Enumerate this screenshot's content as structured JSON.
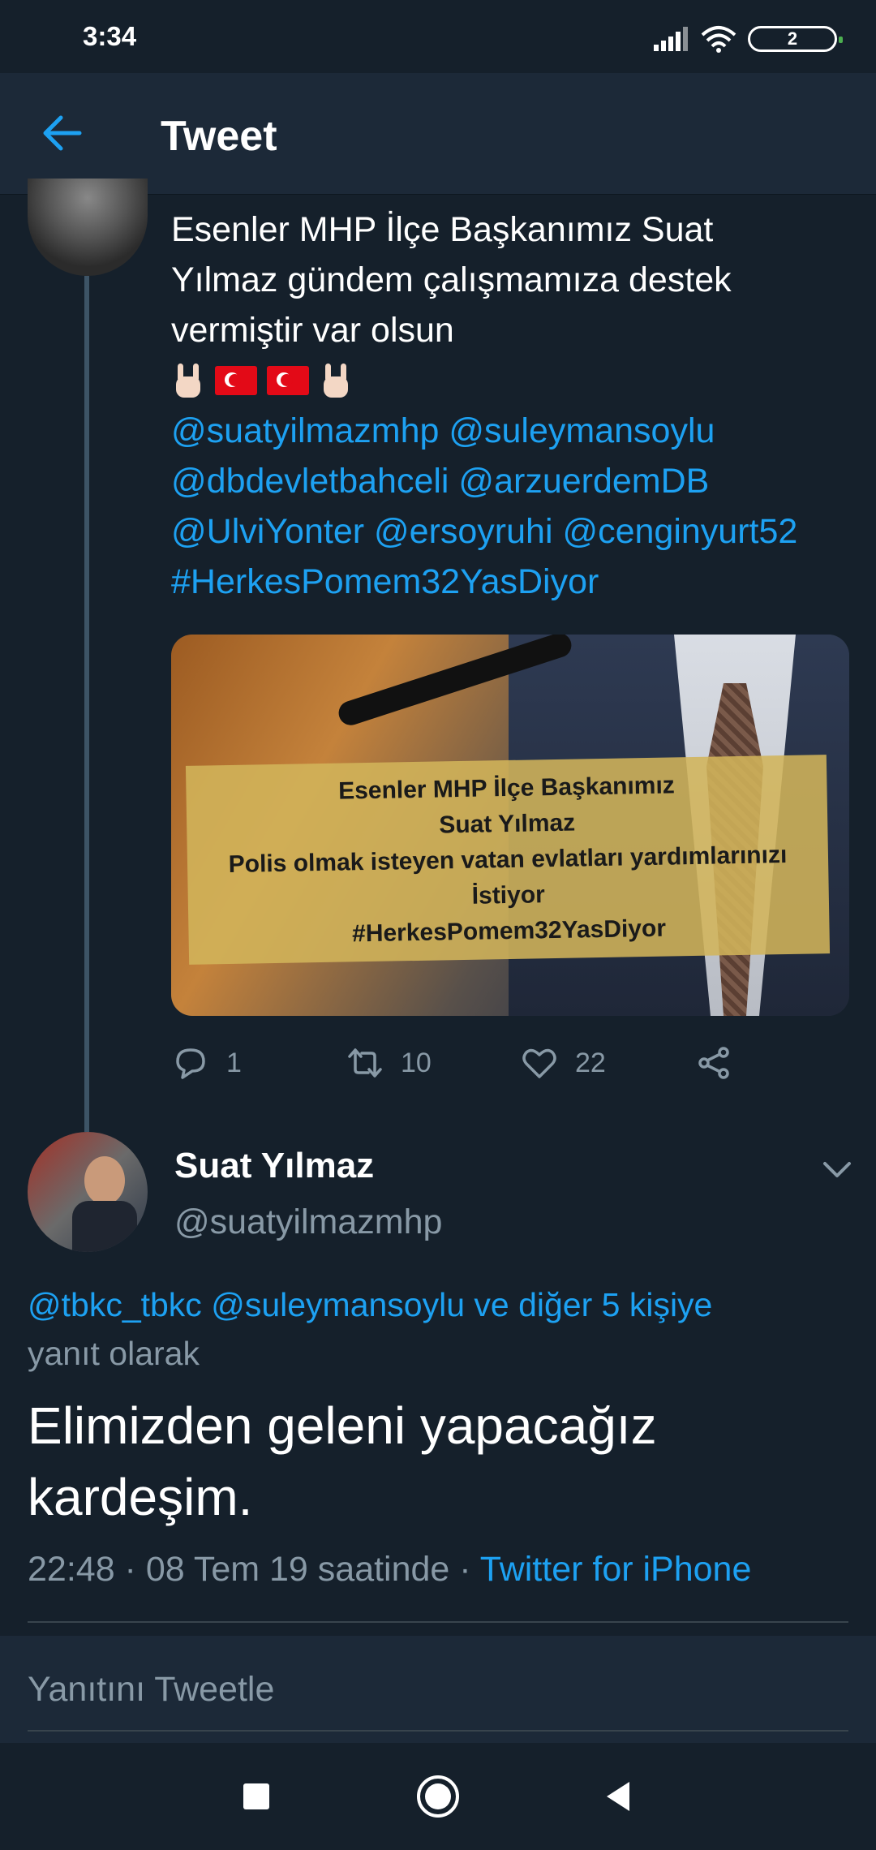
{
  "status_bar": {
    "time": "3:34",
    "battery": "2",
    "icons": [
      "signal-icon",
      "wifi-icon",
      "battery-icon"
    ]
  },
  "header": {
    "title": "Tweet",
    "back_icon": "back-arrow-icon"
  },
  "parent_tweet": {
    "text_lines": [
      "Esenler MHP İlçe Başkanımız Suat",
      "Yılmaz gündem çalışmamıza destek",
      "vermiştir var olsun"
    ],
    "emojis": [
      "rock-hand",
      "turkey-flag",
      "turkey-flag",
      "rock-hand"
    ],
    "mention_lines": [
      "@suatyilmazmhp @suleymansoylu",
      "@dbdevletbahceli @arzuerdemDB",
      "@UlviYonter @ersoyruhi @cenginyurt52",
      "#HerkesPomem32YasDiyor"
    ],
    "media_overlay_lines": [
      "Esenler MHP İlçe Başkanımız",
      "Suat Yılmaz",
      "Polis olmak isteyen vatan evlatları yardımlarınızı",
      "İstiyor",
      "#HerkesPomem32YasDiyor"
    ],
    "actions": {
      "reply_count": "1",
      "retweet_count": "10",
      "like_count": "22"
    }
  },
  "reply_tweet": {
    "name": "Suat Yılmaz",
    "handle": "@suatyilmazmhp",
    "context_mentions": "@tbkc_tbkc @suleymansoylu ve diğer 5 kişiye",
    "context_suffix": "yanıt olarak",
    "body": "Elimizden geleni yapacağız kardeşim.",
    "meta_time": "22:48 · 08 Tem 19 saatinde · ",
    "meta_source": "Twitter for iPhone"
  },
  "compose": {
    "placeholder": "Yanıtını Tweetle"
  },
  "colors": {
    "background": "#15202b",
    "header": "#1c2938",
    "accent": "#1da1f2",
    "secondary_text": "#8899a6"
  }
}
